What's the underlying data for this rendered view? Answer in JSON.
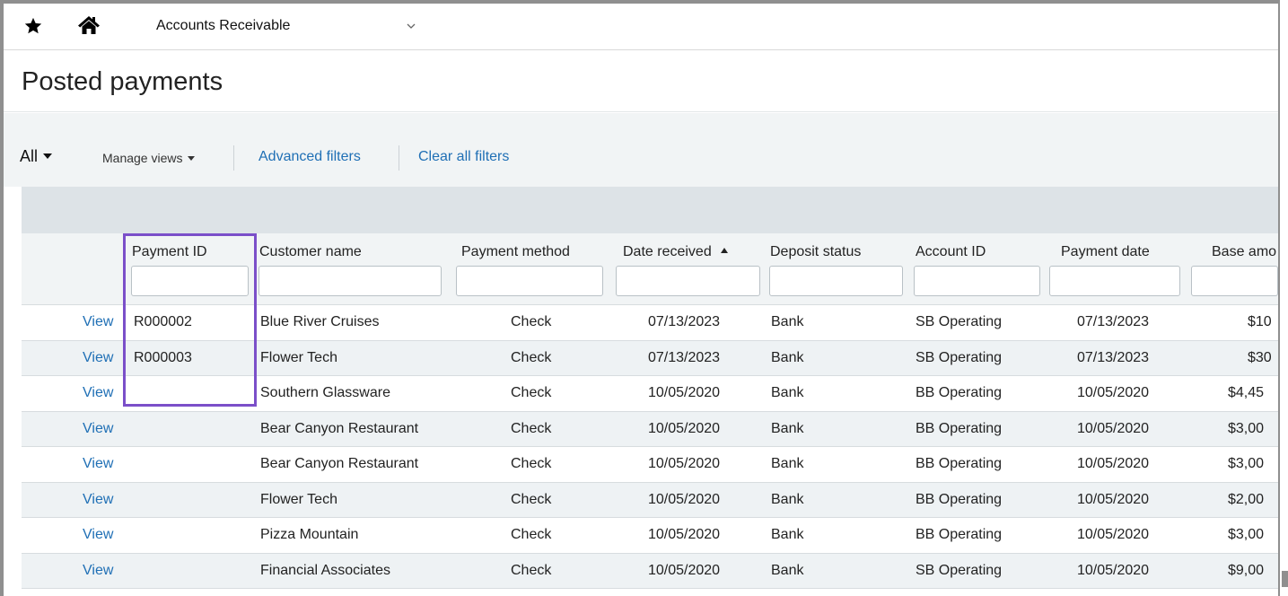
{
  "topbar": {
    "module": "Accounts Receivable"
  },
  "page": {
    "title": "Posted payments"
  },
  "toolbar": {
    "view_selector": "All",
    "manage_views": "Manage views",
    "advanced_filters": "Advanced filters",
    "clear_filters": "Clear all filters"
  },
  "table": {
    "columns": [
      "Payment ID",
      "Customer name",
      "Payment method",
      "Date received",
      "Deposit status",
      "Account ID",
      "Payment date",
      "Base amo"
    ],
    "sorted_column": "Date received",
    "sort_direction": "ascending",
    "row_action": "View",
    "rows": [
      {
        "payment_id": "R000002",
        "customer": "Blue River Cruises",
        "method": "Check",
        "date_received": "07/13/2023",
        "deposit_status": "Bank",
        "account_id": "SB Operating",
        "payment_date": "07/13/2023",
        "base_amount": "$10"
      },
      {
        "payment_id": "R000003",
        "customer": "Flower Tech",
        "method": "Check",
        "date_received": "07/13/2023",
        "deposit_status": "Bank",
        "account_id": "SB Operating",
        "payment_date": "07/13/2023",
        "base_amount": "$30"
      },
      {
        "payment_id": "",
        "customer": "Southern Glassware",
        "method": "Check",
        "date_received": "10/05/2020",
        "deposit_status": "Bank",
        "account_id": "BB Operating",
        "payment_date": "10/05/2020",
        "base_amount": "$4,45"
      },
      {
        "payment_id": "",
        "customer": "Bear Canyon Restaurant",
        "method": "Check",
        "date_received": "10/05/2020",
        "deposit_status": "Bank",
        "account_id": "BB Operating",
        "payment_date": "10/05/2020",
        "base_amount": "$3,00"
      },
      {
        "payment_id": "",
        "customer": "Bear Canyon Restaurant",
        "method": "Check",
        "date_received": "10/05/2020",
        "deposit_status": "Bank",
        "account_id": "BB Operating",
        "payment_date": "10/05/2020",
        "base_amount": "$3,00"
      },
      {
        "payment_id": "",
        "customer": "Flower Tech",
        "method": "Check",
        "date_received": "10/05/2020",
        "deposit_status": "Bank",
        "account_id": "BB Operating",
        "payment_date": "10/05/2020",
        "base_amount": "$2,00"
      },
      {
        "payment_id": "",
        "customer": "Pizza Mountain",
        "method": "Check",
        "date_received": "10/05/2020",
        "deposit_status": "Bank",
        "account_id": "BB Operating",
        "payment_date": "10/05/2020",
        "base_amount": "$3,00"
      },
      {
        "payment_id": "",
        "customer": "Financial Associates",
        "method": "Check",
        "date_received": "10/05/2020",
        "deposit_status": "Bank",
        "account_id": "SB Operating",
        "payment_date": "10/05/2020",
        "base_amount": "$9,00"
      }
    ]
  },
  "colors": {
    "link": "#1f6fb5",
    "highlight": "#7b4fc9",
    "toolbar_bg": "#f1f4f5",
    "grid_band": "#dde3e7"
  },
  "icons": {
    "favorite": "star-icon",
    "home": "home-icon",
    "module_dropdown": "chevron-down-icon"
  }
}
